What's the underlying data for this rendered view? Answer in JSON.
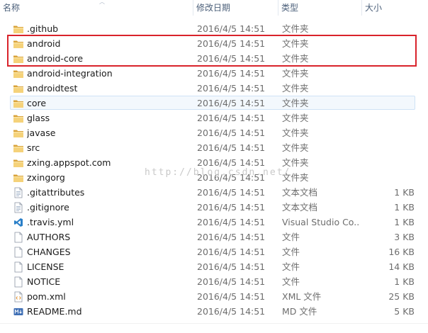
{
  "columns": {
    "name": "名称",
    "date": "修改日期",
    "type": "类型",
    "size": "大小"
  },
  "watermark": "http://blog.csdn.net/",
  "files": [
    {
      "name": ".github",
      "date": "2016/4/5 14:51",
      "type": "文件夹",
      "size": "",
      "icon": "folder-icon"
    },
    {
      "name": "android",
      "date": "2016/4/5 14:51",
      "type": "文件夹",
      "size": "",
      "icon": "folder-icon"
    },
    {
      "name": "android-core",
      "date": "2016/4/5 14:51",
      "type": "文件夹",
      "size": "",
      "icon": "folder-icon"
    },
    {
      "name": "android-integration",
      "date": "2016/4/5 14:51",
      "type": "文件夹",
      "size": "",
      "icon": "folder-icon"
    },
    {
      "name": "androidtest",
      "date": "2016/4/5 14:51",
      "type": "文件夹",
      "size": "",
      "icon": "folder-icon"
    },
    {
      "name": "core",
      "date": "2016/4/5 14:51",
      "type": "文件夹",
      "size": "",
      "icon": "folder-icon",
      "selected": true
    },
    {
      "name": "glass",
      "date": "2016/4/5 14:51",
      "type": "文件夹",
      "size": "",
      "icon": "folder-icon"
    },
    {
      "name": "javase",
      "date": "2016/4/5 14:51",
      "type": "文件夹",
      "size": "",
      "icon": "folder-icon"
    },
    {
      "name": "src",
      "date": "2016/4/5 14:51",
      "type": "文件夹",
      "size": "",
      "icon": "folder-icon"
    },
    {
      "name": "zxing.appspot.com",
      "date": "2016/4/5 14:51",
      "type": "文件夹",
      "size": "",
      "icon": "folder-icon"
    },
    {
      "name": "zxingorg",
      "date": "2016/4/5 14:51",
      "type": "文件夹",
      "size": "",
      "icon": "folder-icon"
    },
    {
      "name": ".gitattributes",
      "date": "2016/4/5 14:51",
      "type": "文本文档",
      "size": "1 KB",
      "icon": "text-document-icon"
    },
    {
      "name": ".gitignore",
      "date": "2016/4/5 14:51",
      "type": "文本文档",
      "size": "1 KB",
      "icon": "text-document-icon"
    },
    {
      "name": ".travis.yml",
      "date": "2016/4/5 14:51",
      "type": "Visual Studio Co...",
      "size": "1 KB",
      "icon": "vscode-icon"
    },
    {
      "name": "AUTHORS",
      "date": "2016/4/5 14:51",
      "type": "文件",
      "size": "3 KB",
      "icon": "file-icon"
    },
    {
      "name": "CHANGES",
      "date": "2016/4/5 14:51",
      "type": "文件",
      "size": "16 KB",
      "icon": "file-icon"
    },
    {
      "name": "LICENSE",
      "date": "2016/4/5 14:51",
      "type": "文件",
      "size": "14 KB",
      "icon": "file-icon"
    },
    {
      "name": "NOTICE",
      "date": "2016/4/5 14:51",
      "type": "文件",
      "size": "1 KB",
      "icon": "file-icon"
    },
    {
      "name": "pom.xml",
      "date": "2016/4/5 14:51",
      "type": "XML 文件",
      "size": "25 KB",
      "icon": "xml-file-icon"
    },
    {
      "name": "README.md",
      "date": "2016/4/5 14:51",
      "type": "MD 文件",
      "size": "5 KB",
      "icon": "markdown-file-icon"
    }
  ]
}
